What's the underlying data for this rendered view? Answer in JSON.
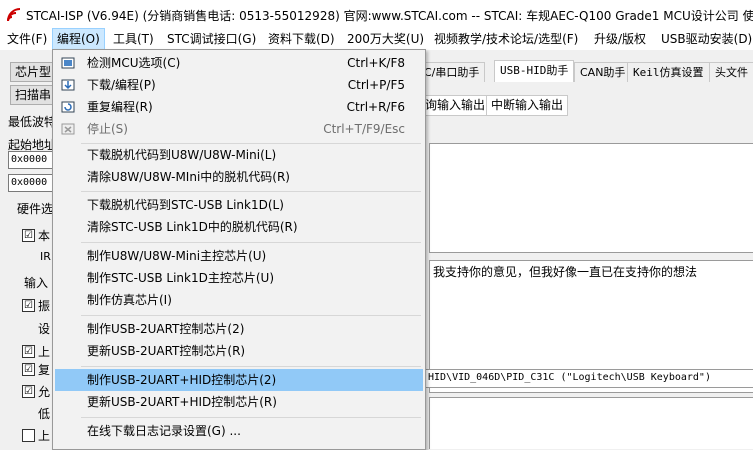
{
  "window": {
    "title": "STCAI-ISP (V6.94E) (分销商销售电话: 0513-55012928) 官网:www.STCAI.com  -- STCAI: 车规AEC-Q100 Grade1 MCU设计公司 使用"
  },
  "menubar": {
    "items": [
      {
        "label": "文件(F)"
      },
      {
        "label": "编程(O)"
      },
      {
        "label": "工具(T)"
      },
      {
        "label": "STC调试接口(G)"
      },
      {
        "label": "资料下载(D)"
      },
      {
        "label": "200万大奖(U)"
      },
      {
        "label": "视频教学/技术论坛/选型(F)"
      },
      {
        "label": "升级/版权"
      },
      {
        "label": "USB驱动安装(D)"
      }
    ]
  },
  "left_panel": {
    "chip_type_btn": "芯片型",
    "scan_btn": "扫描串",
    "min_baud_label": "最低波特",
    "start_addr_label": "起始地址",
    "addr1_value": "0x0000",
    "addr2_value": "0x0000",
    "hw_options_label": "硬件选",
    "rows": [
      {
        "check": "☑",
        "text": "本"
      },
      {
        "check": "",
        "text": "IR"
      },
      {
        "check": "",
        "text": "输入"
      },
      {
        "check": "☑",
        "text": "振"
      },
      {
        "check": "",
        "text": "设"
      },
      {
        "check": "☑",
        "text": "上"
      },
      {
        "check": "☑",
        "text": "复"
      },
      {
        "check": "☑",
        "text": "允"
      },
      {
        "check": "",
        "text": "低"
      },
      {
        "check": "☐",
        "text": "上"
      }
    ]
  },
  "right_panel": {
    "tabs": [
      {
        "label": "C/串口助手",
        "mono": false
      },
      {
        "label": "USB-HID助手",
        "mono": true,
        "selected": true
      },
      {
        "label": "CAN助手",
        "mono": false
      },
      {
        "label": "Keil仿真设置",
        "mono": true
      },
      {
        "label": "头文件",
        "mono": false
      }
    ],
    "subtabs": [
      {
        "label": "询输入输出"
      },
      {
        "label": "中断输入输出"
      }
    ],
    "receive_text": "我支持你的意见，但我好像一直已在支持你的想法",
    "device_path": "HID\\VID_046D\\PID_C31C (\"Logitech\\USB Keyboard\")"
  },
  "dropdown": {
    "items": [
      {
        "label": "检测MCU选项(C)",
        "shortcut": "Ctrl+K/F8",
        "icon": "detect-icon",
        "disabled": false
      },
      {
        "label": "下载/编程(P)",
        "shortcut": "Ctrl+P/F5",
        "icon": "download-icon",
        "disabled": false
      },
      {
        "label": "重复编程(R)",
        "shortcut": "Ctrl+R/F6",
        "icon": "repeat-icon",
        "disabled": false
      },
      {
        "label": "停止(S)",
        "shortcut": "Ctrl+T/F9/Esc",
        "icon": "stop-icon",
        "disabled": true
      },
      {
        "label": "下载脱机代码到U8W/U8W-Mini(L)",
        "shortcut": "",
        "disabled": false
      },
      {
        "label": "清除U8W/U8W-MIni中的脱机代码(R)",
        "shortcut": "",
        "disabled": false
      },
      {
        "label": "下载脱机代码到STC-USB Link1D(L)",
        "shortcut": "",
        "disabled": false
      },
      {
        "label": "清除STC-USB Link1D中的脱机代码(R)",
        "shortcut": "",
        "disabled": false
      },
      {
        "label": "制作U8W/U8W-Mini主控芯片(U)",
        "shortcut": "",
        "disabled": false
      },
      {
        "label": "制作STC-USB Link1D主控芯片(U)",
        "shortcut": "",
        "disabled": false
      },
      {
        "label": "制作仿真芯片(I)",
        "shortcut": "",
        "disabled": false
      },
      {
        "label": "制作USB-2UART控制芯片(2)",
        "shortcut": "",
        "disabled": false
      },
      {
        "label": "更新USB-2UART控制芯片(R)",
        "shortcut": "",
        "disabled": false
      },
      {
        "label": "制作USB-2UART+HID控制芯片(2)",
        "shortcut": "",
        "disabled": false,
        "highlighted": true
      },
      {
        "label": "更新USB-2UART+HID控制芯片(R)",
        "shortcut": "",
        "disabled": false
      },
      {
        "label": "在线下载日志记录设置(G) ...",
        "shortcut": "",
        "disabled": false
      }
    ]
  },
  "colors": {
    "highlight": "#91c9f7",
    "menu_active": "#cce8ff"
  }
}
